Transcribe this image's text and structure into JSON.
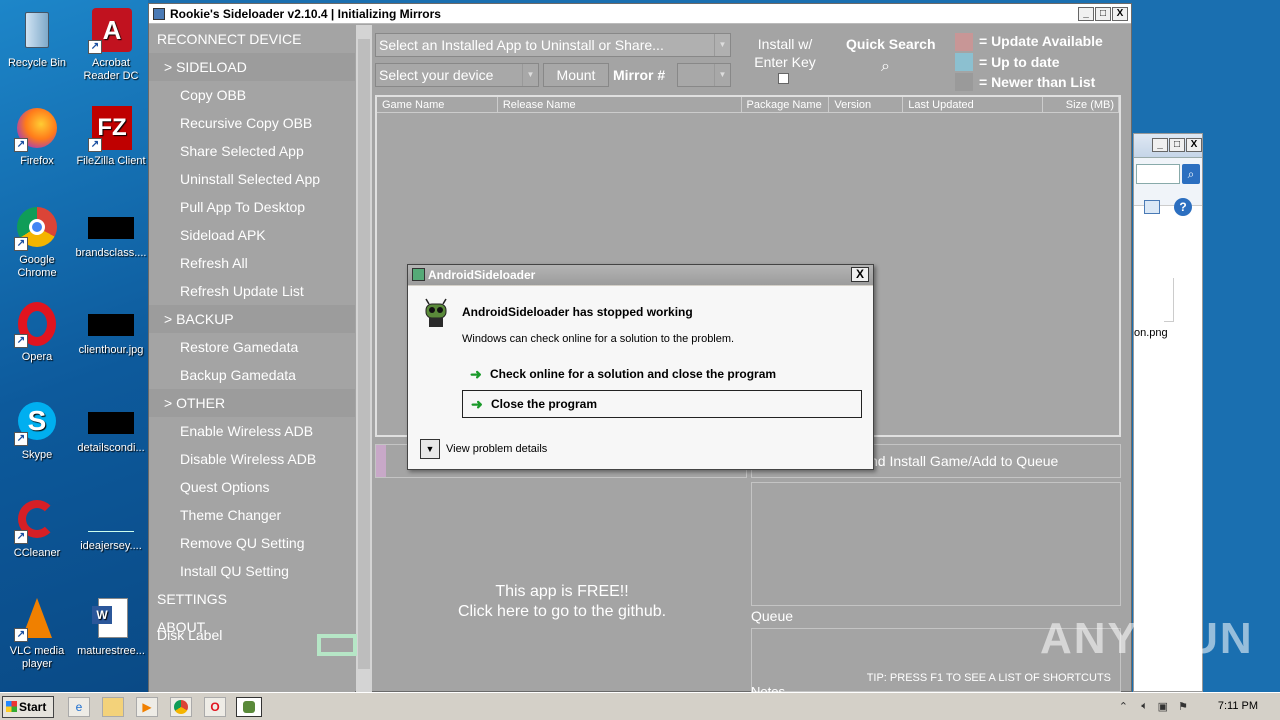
{
  "desktop": {
    "icons": [
      {
        "label": "Recycle Bin"
      },
      {
        "label": "Acrobat Reader DC"
      },
      {
        "label": "Firefox"
      },
      {
        "label": "FileZilla Client"
      },
      {
        "label": "Google Chrome"
      },
      {
        "label": "brandsclass...."
      },
      {
        "label": "Opera"
      },
      {
        "label": "clienthour.jpg"
      },
      {
        "label": "Skype"
      },
      {
        "label": "detailscondi..."
      },
      {
        "label": "CCleaner"
      },
      {
        "label": "ideajersey...."
      },
      {
        "label": "VLC media player"
      },
      {
        "label": "maturestree..."
      }
    ],
    "icon_glyphs": {
      "filezilla": "FZ",
      "skype": "S",
      "opera": "O",
      "word": "W",
      "acrobat": "A"
    }
  },
  "window": {
    "title": "Rookie's Sideloader v2.10.4 | Initializing Mirrors",
    "controls": {
      "minimize": "_",
      "maximize": "□",
      "close": "X"
    }
  },
  "sidebar": {
    "items": [
      {
        "label": "RECONNECT DEVICE",
        "kind": "top"
      },
      {
        "label": "> SIDELOAD",
        "kind": "section"
      },
      {
        "label": "Copy OBB",
        "kind": "sub"
      },
      {
        "label": "Recursive Copy OBB",
        "kind": "sub"
      },
      {
        "label": "Share Selected App",
        "kind": "sub"
      },
      {
        "label": "Uninstall Selected App",
        "kind": "sub"
      },
      {
        "label": "Pull App To Desktop",
        "kind": "sub"
      },
      {
        "label": "Sideload APK",
        "kind": "sub"
      },
      {
        "label": "Refresh All",
        "kind": "sub"
      },
      {
        "label": "Refresh Update List",
        "kind": "sub"
      },
      {
        "label": "> BACKUP",
        "kind": "section"
      },
      {
        "label": "Restore Gamedata",
        "kind": "sub"
      },
      {
        "label": "Backup Gamedata",
        "kind": "sub"
      },
      {
        "label": "> OTHER",
        "kind": "section"
      },
      {
        "label": "Enable Wireless ADB",
        "kind": "sub"
      },
      {
        "label": "Disable Wireless ADB",
        "kind": "sub"
      },
      {
        "label": "Quest Options",
        "kind": "sub"
      },
      {
        "label": "Theme Changer",
        "kind": "sub"
      },
      {
        "label": "Remove QU Setting",
        "kind": "sub"
      },
      {
        "label": "Install QU Setting",
        "kind": "sub"
      },
      {
        "label": "SETTINGS",
        "kind": "top"
      },
      {
        "label": "ABOUT",
        "kind": "top"
      }
    ],
    "disk_label": "Disk Label"
  },
  "toolbar": {
    "installed_app_value": "Select an Installed App to Uninstall or Share...",
    "device_value": "Select your device",
    "mount_label": "Mount",
    "mirror_label": "Mirror #",
    "install_enter_label": "Install w/ Enter Key",
    "quick_search_label": "Quick Search"
  },
  "legend": {
    "update_available": "= Update Available",
    "up_to_date": "= Up to date",
    "newer_than_list": "= Newer than List",
    "colors": {
      "update_available": "#c89696",
      "up_to_date": "#8cc0d0",
      "newer_than_list": "#9a9a9a"
    }
  },
  "grid": {
    "columns": [
      "Game Name",
      "Release Name",
      "Package Name",
      "Version",
      "Last Updated",
      "Size (MB)"
    ]
  },
  "download_button_label": "nd Install Game/Add to Queue",
  "free_text": {
    "line1": "This app is FREE!!",
    "line2": "Click here to go to the github."
  },
  "queue_label": "Queue",
  "notes_label": "Notes",
  "tip": "TIP: PRESS F1 TO SEE A LIST OF SHORTCUTS",
  "dialog": {
    "title": "AndroidSideloader",
    "heading": "AndroidSideloader has stopped working",
    "subtext": "Windows can check online for a solution to the problem.",
    "option1": "Check online for a solution and close the program",
    "option2": "Close the program",
    "details": "View problem details"
  },
  "right_window": {
    "file_label": "on.png"
  },
  "taskbar": {
    "start_label": "Start",
    "clock": "7:11 PM"
  },
  "watermark": "ANY RUN"
}
